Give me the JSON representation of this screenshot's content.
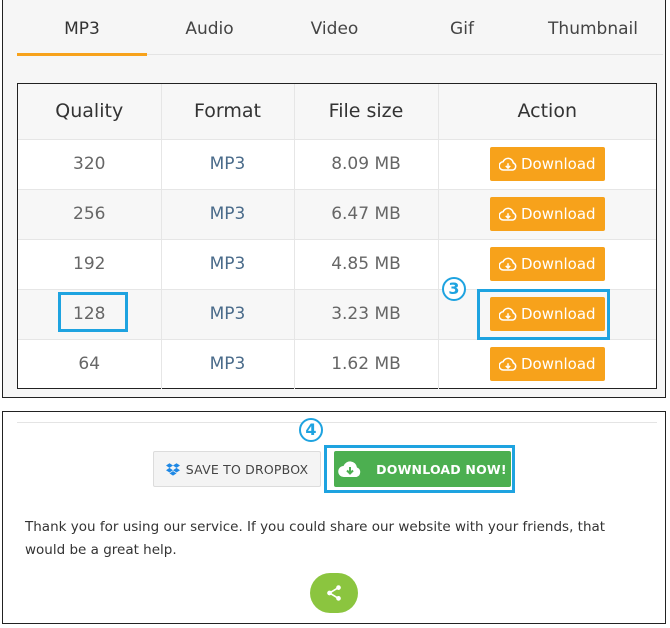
{
  "tabs": [
    {
      "label": "MP3",
      "active": true
    },
    {
      "label": "Audio",
      "active": false
    },
    {
      "label": "Video",
      "active": false
    },
    {
      "label": "Gif",
      "active": false
    },
    {
      "label": "Thumbnail",
      "active": false
    }
  ],
  "table": {
    "headers": [
      "Quality",
      "Format",
      "File size",
      "Action"
    ],
    "rows": [
      {
        "quality": "320",
        "format": "MP3",
        "size": "8.09 MB",
        "action": "Download"
      },
      {
        "quality": "256",
        "format": "MP3",
        "size": "6.47 MB",
        "action": "Download"
      },
      {
        "quality": "192",
        "format": "MP3",
        "size": "4.85 MB",
        "action": "Download"
      },
      {
        "quality": "128",
        "format": "MP3",
        "size": "3.23 MB",
        "action": "Download"
      },
      {
        "quality": "64",
        "format": "MP3",
        "size": "1.62 MB",
        "action": "Download"
      }
    ]
  },
  "steps": {
    "step3": "3",
    "step4": "4"
  },
  "bottom": {
    "dropbox_label": "SAVE TO DROPBOX",
    "download_now_label": "DOWNLOAD NOW!",
    "thanks_text": "Thank you for using our service. If you could share our website with your friends, that would be a great help."
  },
  "colors": {
    "accent_orange": "#f7a21b",
    "highlight_blue": "#1ea3e0",
    "download_green": "#4caf50",
    "share_green": "#8bc53f"
  },
  "icons": {
    "download_row": "cloud-download-icon",
    "dropbox": "dropbox-icon",
    "download_now": "cloud-download-icon",
    "share": "share-icon"
  }
}
